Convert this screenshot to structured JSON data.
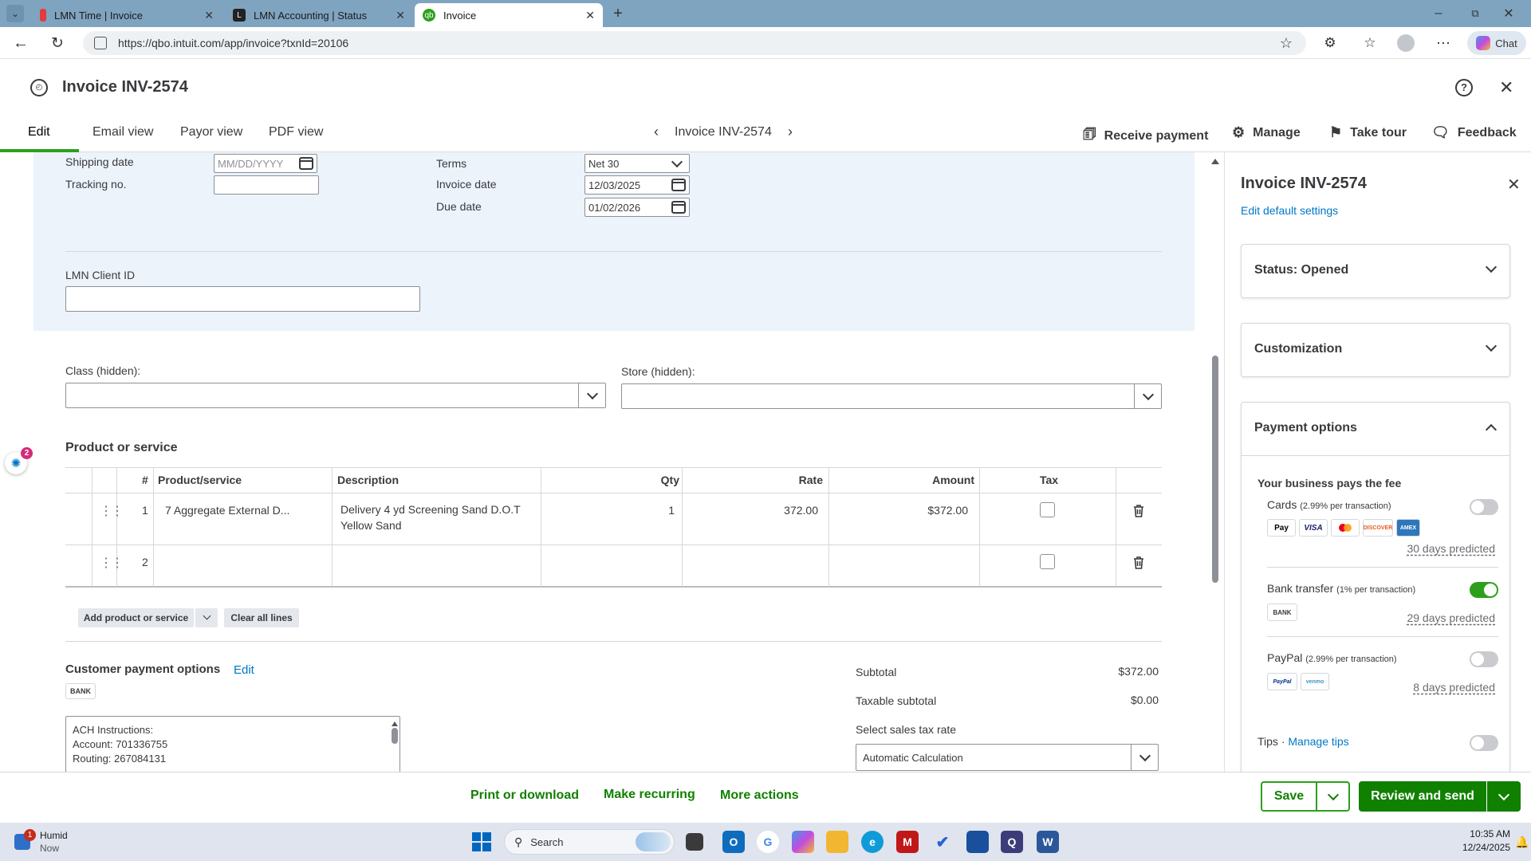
{
  "browser": {
    "tabs": [
      {
        "title": "LMN Time | Invoice"
      },
      {
        "title": "LMN Accounting | Status"
      },
      {
        "title": "Invoice"
      }
    ],
    "url": "https://qbo.intuit.com/app/invoice?txnId=20106",
    "chat_label": "Chat"
  },
  "header": {
    "title": "Invoice INV-2574",
    "tabs": [
      "Edit",
      "Email view",
      "Payor view",
      "PDF view"
    ],
    "nav_title": "Invoice INV-2574",
    "actions": {
      "receive_payment": "Receive payment",
      "manage": "Manage",
      "take_tour": "Take tour",
      "feedback": "Feedback"
    }
  },
  "form": {
    "shipping_date_label": "Shipping date",
    "shipping_date_placeholder": "MM/DD/YYYY",
    "tracking_label": "Tracking no.",
    "terms_label": "Terms",
    "terms_value": "Net 30",
    "invoice_date_label": "Invoice date",
    "invoice_date_value": "12/03/2025",
    "due_date_label": "Due date",
    "due_date_value": "01/02/2026",
    "client_id_label": "LMN Client ID",
    "class_label": "Class (hidden):",
    "store_label": "Store (hidden):",
    "product_section_title": "Product or service",
    "badge_count": "2"
  },
  "table": {
    "headers": {
      "num": "#",
      "product": "Product/service",
      "description": "Description",
      "qty": "Qty",
      "rate": "Rate",
      "amount": "Amount",
      "tax": "Tax"
    },
    "rows": [
      {
        "num": "1",
        "product": "7 Aggregate External D...",
        "description_line1": "Delivery 4 yd Screening Sand D.O.T",
        "description_line2": "Yellow Sand",
        "qty": "1",
        "rate": "372.00",
        "amount": "$372.00"
      },
      {
        "num": "2",
        "product": "",
        "description_line1": "",
        "description_line2": "",
        "qty": "",
        "rate": "",
        "amount": ""
      }
    ],
    "add_button": "Add product or service",
    "clear_button": "Clear all lines"
  },
  "payment_options": {
    "title": "Customer payment options",
    "edit": "Edit",
    "bank_tag": "BANK",
    "ach_lines": [
      "ACH Instructions:",
      "Account: 701336755",
      "Routing: 267084131"
    ]
  },
  "totals": {
    "subtotal_label": "Subtotal",
    "subtotal_value": "$372.00",
    "taxable_label": "Taxable subtotal",
    "taxable_value": "$0.00",
    "tax_rate_label": "Select sales tax rate",
    "tax_rate_value": "Automatic Calculation"
  },
  "sidebar": {
    "title": "Invoice INV-2574",
    "edit_defaults": "Edit default settings",
    "status": "Status: Opened",
    "customization": "Customization",
    "payment_options": "Payment options",
    "fee_label": "Your business pays the fee",
    "cards_label": "Cards",
    "cards_fee": "(2.99% per transaction)",
    "card_brands": [
      "Pay",
      "VISA",
      "MC",
      "DISCOVER",
      "AMEX"
    ],
    "cards_predicted": "30 days predicted",
    "bank_label": "Bank transfer",
    "bank_fee": "(1% per transaction)",
    "bank_tag": "BANK",
    "bank_predicted": "29 days predicted",
    "paypal_label": "PayPal",
    "paypal_fee": "(2.99% per transaction)",
    "paypal_brands": [
      "PayPal",
      "venmo"
    ],
    "paypal_predicted": "8 days predicted",
    "tips_label": "Tips",
    "tips_sep": "·",
    "manage_tips": "Manage tips",
    "toggles": {
      "cards": false,
      "bank": true,
      "paypal": false,
      "tips": false
    }
  },
  "footer": {
    "print": "Print or download",
    "recurring": "Make recurring",
    "more": "More actions",
    "save": "Save",
    "review_send": "Review and send"
  },
  "taskbar": {
    "weather_title": "Humid",
    "weather_sub": "Now",
    "weather_badge": "1",
    "search": "Search",
    "time": "10:35 AM",
    "date": "12/24/2025"
  },
  "colors": {
    "accent_green": "#2ca01c",
    "dark_green": "#108000",
    "link_blue": "#0077c5",
    "form_blue": "#ecf3fb"
  }
}
